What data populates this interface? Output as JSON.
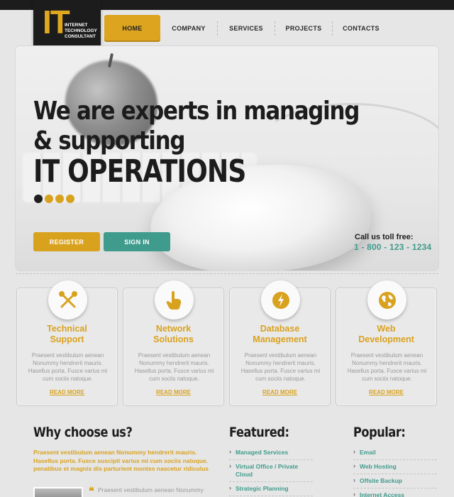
{
  "logo": {
    "mark": "IT",
    "text": "INTERNET TECHNOLOGY CONSULTANT"
  },
  "nav": [
    "HOME",
    "COMPANY",
    "SERVICES",
    "PROJECTS",
    "CONTACTS"
  ],
  "hero": {
    "line1": "We are experts in managing",
    "line2": "& supporting",
    "line3": "IT OPERATIONS",
    "register_label": "REGISTER",
    "signin_label": "SIGN IN",
    "call_label": "Call us toll free:",
    "phone": "1 - 800 - 123 - 1234",
    "slides": 4,
    "active_slide": 1
  },
  "services": [
    {
      "title1": "Technical",
      "title2": "Support",
      "icon": "tools-icon",
      "desc": "Praesent vestibulum aenean Nonummy hendrerit mauris. Hasellus porta. Fusce varius mi cum sociis natoque.",
      "more": "READ MORE"
    },
    {
      "title1": "Network",
      "title2": "Solutions",
      "icon": "pointer-hand-icon",
      "desc": "Praesent vestibulum aenean Nonummy hendrerit mauris. Hasellus porta. Fusce varius mi cum sociis natoque.",
      "more": "READ MORE"
    },
    {
      "title1": "Database",
      "title2": "Management",
      "icon": "database-icon",
      "desc": "Praesent vestibulum aenean Nonummy hendrerit mauris. Hasellus porta. Fusce varius mi cum sociis natoque.",
      "more": "READ MORE"
    },
    {
      "title1": "Web",
      "title2": "Development",
      "icon": "globe-icon",
      "desc": "Praesent vestibulum aenean Nonummy hendrerit mauris. Hasellus porta. Fusce varius mi cum sociis natoque.",
      "more": "READ MORE"
    }
  ],
  "why": {
    "title": "Why choose us?",
    "text": "Praesent vestibulum aenean Nonummy hendrerit mauris. Hasellus porta. Fusce suscipit varius mi cum sociis natoque. penatibus et magnis dis parturient montes nascetur ridiculus",
    "quote": "Praesent vestibulum aenean Nonummy"
  },
  "featured": {
    "title": "Featured:",
    "items": [
      "Managed Services",
      "Virtual Office / Private Cloud",
      "Strategic Planning"
    ]
  },
  "popular": {
    "title": "Popular:",
    "items": [
      "Email",
      "Web Hosting",
      "Offsite Backup",
      "Internet Access"
    ]
  },
  "colors": {
    "accent": "#d9a21e",
    "teal": "#3f9b8c",
    "dark": "#1c1c1c"
  }
}
